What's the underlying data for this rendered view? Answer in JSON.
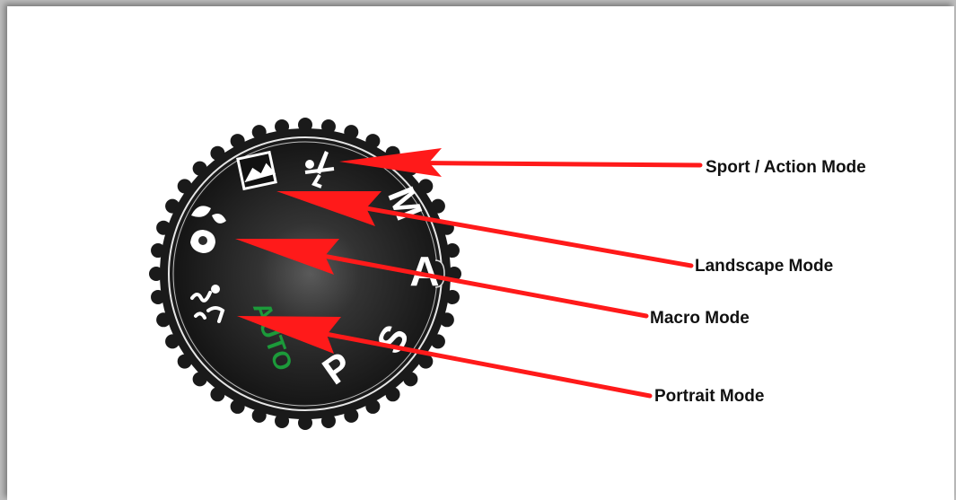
{
  "dial": {
    "modes": {
      "m": "M",
      "a": "A",
      "s": "S",
      "p": "P",
      "auto": "AUTO"
    }
  },
  "callouts": {
    "sport": "Sport / Action Mode",
    "landscape": "Landscape Mode",
    "macro": "Macro Mode",
    "portrait": "Portrait Mode"
  },
  "colors": {
    "arrow": "#ff1a1a",
    "auto_text": "#1c9a3a",
    "dial_body": "#1a1a1a"
  }
}
